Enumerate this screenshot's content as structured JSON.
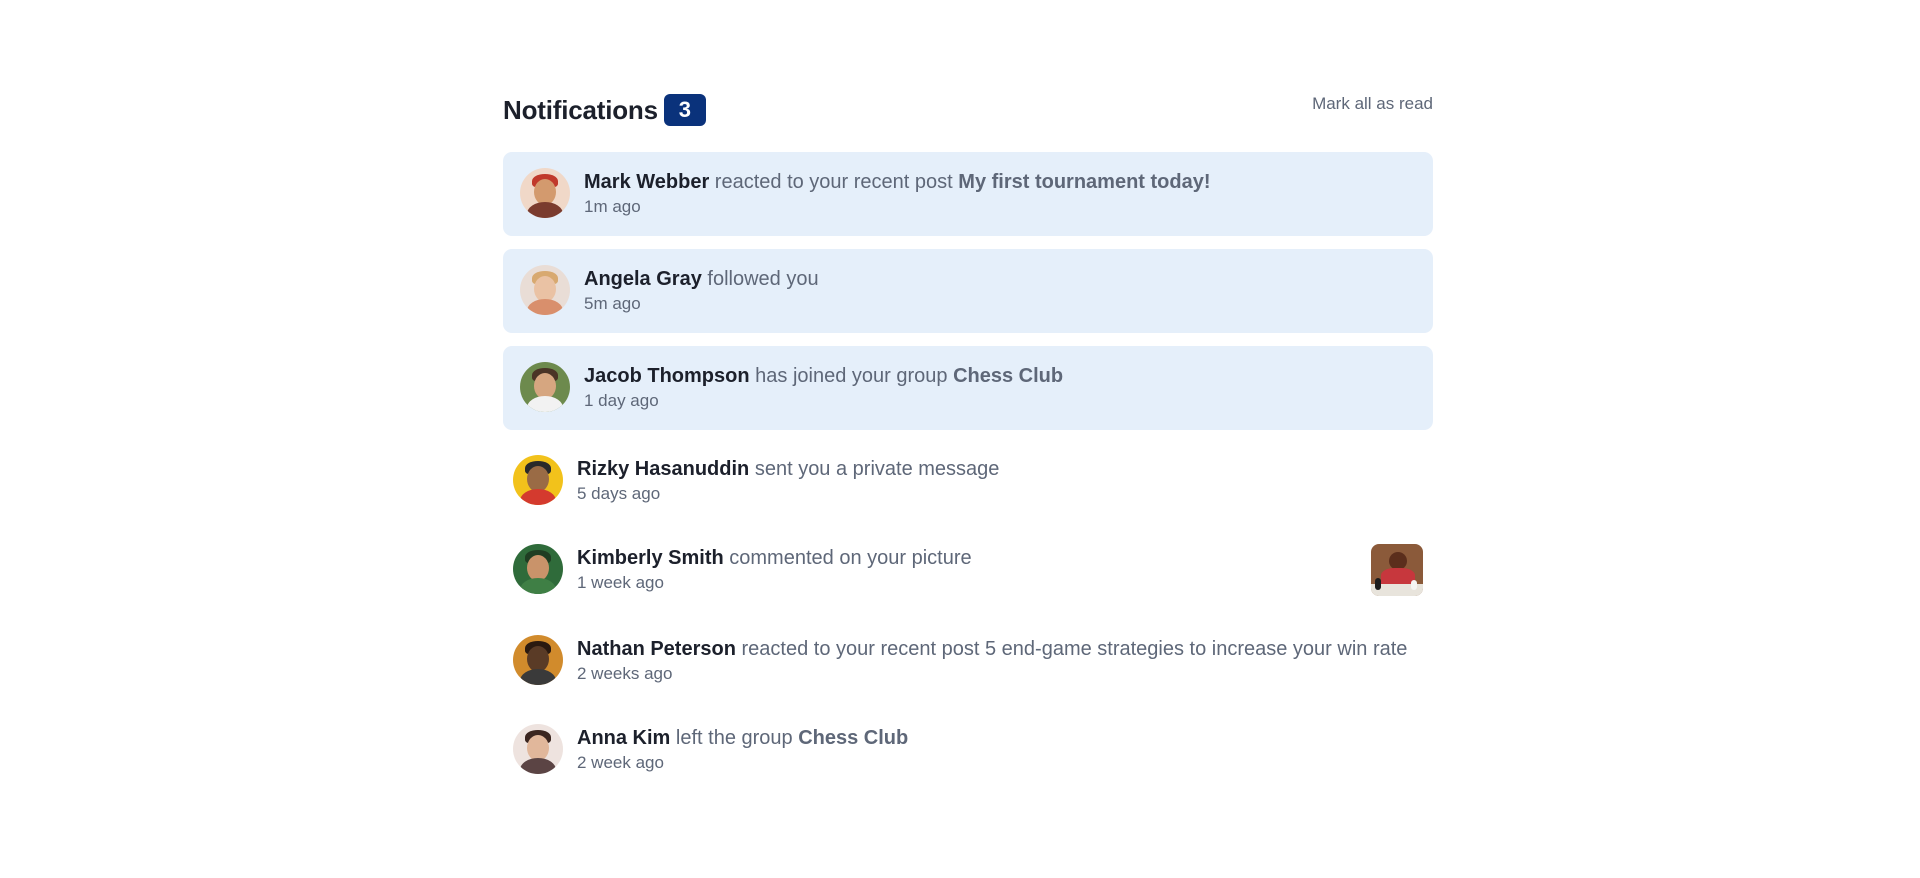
{
  "header": {
    "title": "Notifications",
    "count": "3",
    "mark_all_label": "Mark all as read"
  },
  "notifications": [
    {
      "name": "Mark Webber",
      "action": "reacted to your recent post",
      "target": "My first tournament today!",
      "time": "1m ago",
      "unread": true,
      "avatar": "avatar-mark-webber"
    },
    {
      "name": "Angela Gray",
      "action": "followed you",
      "target": "",
      "time": "5m ago",
      "unread": true,
      "avatar": "avatar-angela-gray"
    },
    {
      "name": "Jacob Thompson",
      "action": "has joined your group",
      "target": "Chess Club",
      "time": "1 day ago",
      "unread": true,
      "avatar": "avatar-jacob-thompson"
    },
    {
      "name": "Rizky Hasanuddin",
      "action": "sent you a private message",
      "target": "",
      "time": "5 days ago",
      "unread": false,
      "avatar": "avatar-rizky-hasanuddin"
    },
    {
      "name": "Kimberly Smith",
      "action": "commented on your picture",
      "target": "",
      "time": "1 week ago",
      "unread": false,
      "avatar": "avatar-kimberly-smith",
      "thumbnail": "chess-picture-thumbnail"
    },
    {
      "name": "Nathan Peterson",
      "action": "reacted to your recent post",
      "target": "5 end-game strategies to increase your win rate",
      "time": "2 weeks ago",
      "unread": false,
      "avatar": "avatar-nathan-peterson"
    },
    {
      "name": "Anna Kim",
      "action": "left the group",
      "target": "Chess Club",
      "time": "2 week ago",
      "unread": false,
      "avatar": "avatar-anna-kim"
    }
  ],
  "colors": {
    "unread_background": "#e5effa",
    "badge_background": "#0a327b",
    "name_text": "#1c202b",
    "body_text": "#5e6778"
  }
}
